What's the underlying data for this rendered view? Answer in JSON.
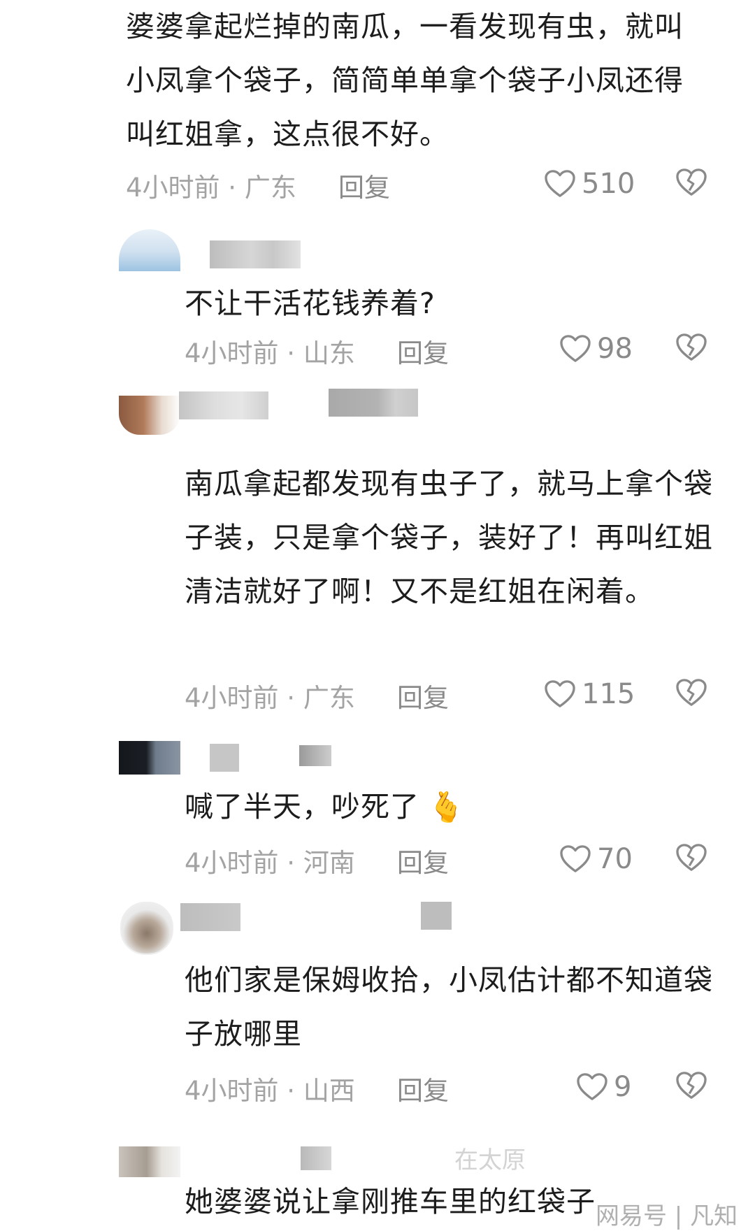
{
  "comments": [
    {
      "text": "婆婆拿起烂掉的南瓜，一看发现有虫，就叫小凤拿个袋子，简简单单拿个袋子小凤还得叫红姐拿，这点很不好。",
      "meta": "4小时前 · 广东",
      "reply": "回复",
      "likes": "510"
    },
    {
      "text": "不让干活花钱养着?",
      "meta": "4小时前 · 山东",
      "reply": "回复",
      "likes": "98"
    },
    {
      "text": "南瓜拿起都发现有虫子了，就马上拿个袋子装，只是拿个袋子，装好了！再叫红姐清洁就好了啊！又不是红姐在闲着。",
      "meta": "4小时前 · 广东",
      "reply": "回复",
      "likes": "115"
    },
    {
      "text": "喊了半天，吵死了",
      "meta": "4小时前 · 河南",
      "reply": "回复",
      "likes": "70",
      "emoji": "🫰"
    },
    {
      "text": "他们家是保姆收拾，小凤估计都不知道袋子放哪里",
      "meta": "4小时前 · 山西",
      "reply": "回复",
      "likes": "9"
    },
    {
      "text": "她婆婆说让拿刚推车里的红袋子",
      "partial_username": "在太原"
    }
  ],
  "watermark": "网易号 | 凡知",
  "icons": {
    "like": "heart-outline-icon",
    "dislike": "broken-heart-icon"
  },
  "colors": {
    "text": "#1c1c1c",
    "meta": "#a3a3a3",
    "icon": "#8a8a8a"
  }
}
